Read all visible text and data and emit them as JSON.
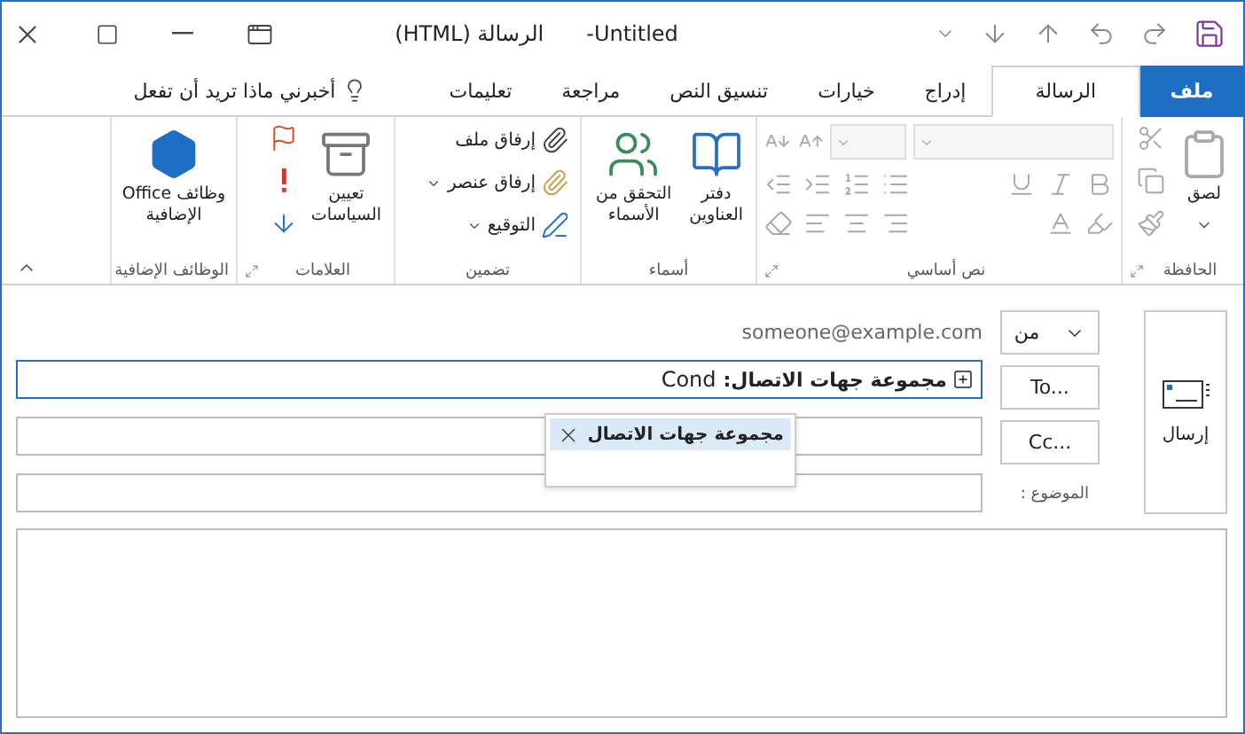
{
  "title_bar": {
    "document": "Untitled-",
    "app": "الرسالة (HTML)"
  },
  "tabs": [
    {
      "label": "ملف",
      "kind": "file",
      "selected": false
    },
    {
      "label": "الرسالة",
      "kind": "tab",
      "selected": true
    },
    {
      "label": "إدراج",
      "kind": "tab",
      "selected": false
    },
    {
      "label": "خيارات",
      "kind": "tab",
      "selected": false
    },
    {
      "label": "تنسيق النص",
      "kind": "tab",
      "selected": false
    },
    {
      "label": "مراجعة",
      "kind": "tab",
      "selected": false
    },
    {
      "label": "تعليمات",
      "kind": "tab",
      "selected": false
    }
  ],
  "tell_me": "أخبرني ماذا تريد أن تفعل",
  "ribbon": {
    "clipboard": {
      "label": "الحافظة",
      "paste": "لصق",
      "tools_disabled": true
    },
    "basic_text": {
      "label": "نص أساسي",
      "disabled": true
    },
    "names": {
      "label": "أسماء",
      "address_book": [
        "دفتر",
        "العناوين"
      ],
      "check_names": [
        "التحقق من",
        "الأسماء"
      ]
    },
    "include": {
      "label": "تضمين",
      "attach_file": "إرفاق ملف",
      "attach_item": "إرفاق عنصر",
      "signature": "التوقيع"
    },
    "tags": {
      "label": "العلامات",
      "assign_policy": [
        "تعيين",
        "السياسات"
      ]
    },
    "add_ins": {
      "label": "الوظائف الإضافية",
      "office_add_ins": [
        "وظائف Office",
        "الإضافية"
      ]
    }
  },
  "compose": {
    "send": "إرسال",
    "from_button": "من",
    "from_address": "someone@example.com",
    "to_button": "To...",
    "cc_button": "Cc...",
    "to_chip": "مجموعة جهات الاتصال:",
    "to_typed": "Cond",
    "suggestion": "مجموعة جهات الاتصال",
    "subject_label": "الموضوع :"
  }
}
